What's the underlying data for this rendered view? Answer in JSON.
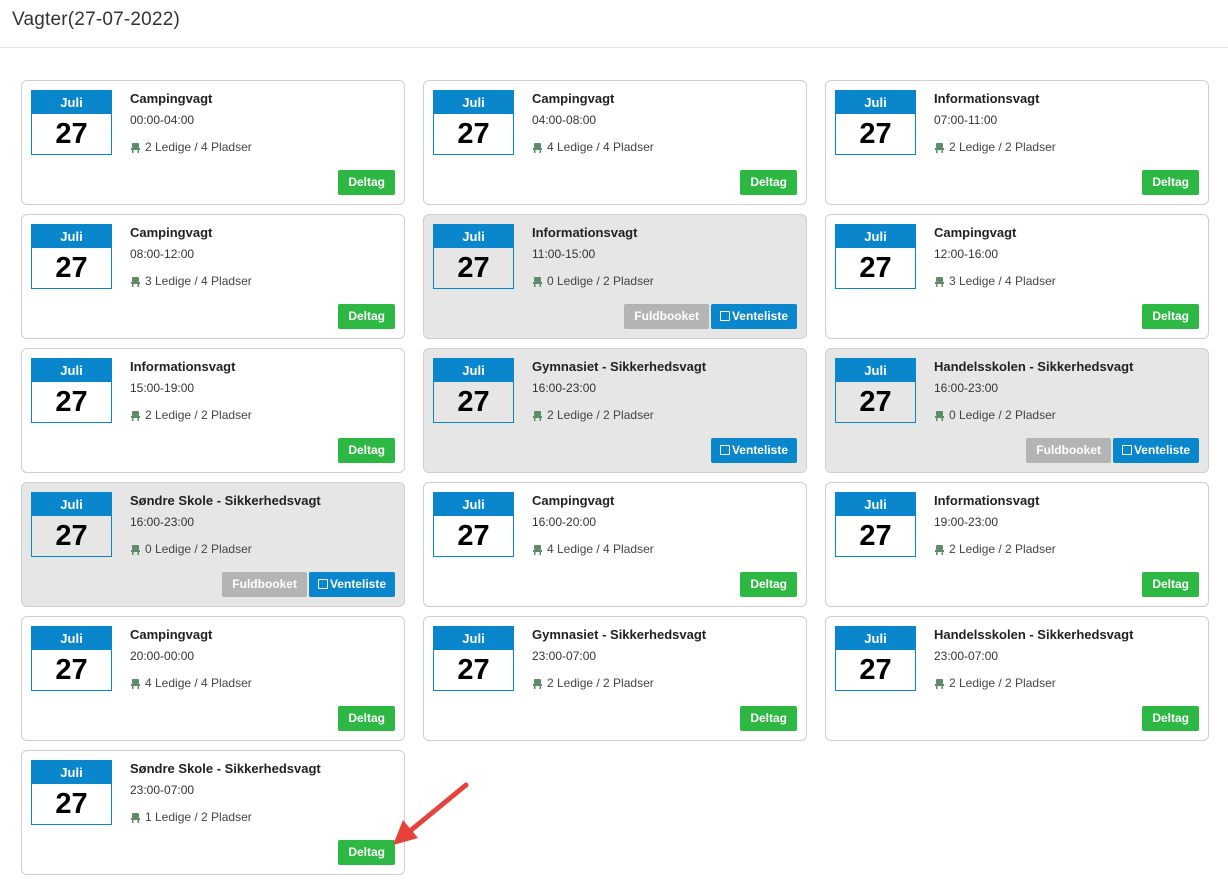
{
  "page": {
    "title": "Vagter(27-07-2022)"
  },
  "colors": {
    "accent": "#0a86cc",
    "join": "#2db843",
    "full": "#b4b4b4",
    "arrow": "#e8413c"
  },
  "icons": {
    "seats": "seat-icon",
    "waitlist": "checkbox-icon",
    "annotation": "red-arrow"
  },
  "shifts": [
    {
      "month": "Juli",
      "day": "27",
      "title": "Campingvagt",
      "time": "00:00-04:00",
      "seats": "2 Ledige / 4 Pladser",
      "state": "open",
      "join_label": "Deltag"
    },
    {
      "month": "Juli",
      "day": "27",
      "title": "Campingvagt",
      "time": "04:00-08:00",
      "seats": "4 Ledige / 4 Pladser",
      "state": "open",
      "join_label": "Deltag"
    },
    {
      "month": "Juli",
      "day": "27",
      "title": "Informationsvagt",
      "time": "07:00-11:00",
      "seats": "2 Ledige / 2 Pladser",
      "state": "open",
      "join_label": "Deltag"
    },
    {
      "month": "Juli",
      "day": "27",
      "title": "Campingvagt",
      "time": "08:00-12:00",
      "seats": "3 Ledige / 4 Pladser",
      "state": "open",
      "join_label": "Deltag"
    },
    {
      "month": "Juli",
      "day": "27",
      "title": "Informationsvagt",
      "time": "11:00-15:00",
      "seats": "0 Ledige / 2 Pladser",
      "state": "full",
      "full_label": "Fuldbooket",
      "wait_label": "Venteliste"
    },
    {
      "month": "Juli",
      "day": "27",
      "title": "Campingvagt",
      "time": "12:00-16:00",
      "seats": "3 Ledige / 4 Pladser",
      "state": "open",
      "join_label": "Deltag"
    },
    {
      "month": "Juli",
      "day": "27",
      "title": "Informationsvagt",
      "time": "15:00-19:00",
      "seats": "2 Ledige / 2 Pladser",
      "state": "open",
      "join_label": "Deltag"
    },
    {
      "month": "Juli",
      "day": "27",
      "title": "Gymnasiet - Sikkerhedsvagt",
      "time": "16:00-23:00",
      "seats": "2 Ledige / 2 Pladser",
      "state": "waitlist",
      "wait_label": "Venteliste"
    },
    {
      "month": "Juli",
      "day": "27",
      "title": "Handelsskolen - Sikkerhedsvagt",
      "time": "16:00-23:00",
      "seats": "0 Ledige / 2 Pladser",
      "state": "full",
      "full_label": "Fuldbooket",
      "wait_label": "Venteliste"
    },
    {
      "month": "Juli",
      "day": "27",
      "title": "Søndre Skole - Sikkerhedsvagt",
      "time": "16:00-23:00",
      "seats": "0 Ledige / 2 Pladser",
      "state": "full",
      "full_label": "Fuldbooket",
      "wait_label": "Venteliste"
    },
    {
      "month": "Juli",
      "day": "27",
      "title": "Campingvagt",
      "time": "16:00-20:00",
      "seats": "4 Ledige / 4 Pladser",
      "state": "open",
      "join_label": "Deltag"
    },
    {
      "month": "Juli",
      "day": "27",
      "title": "Informationsvagt",
      "time": "19:00-23:00",
      "seats": "2 Ledige / 2 Pladser",
      "state": "open",
      "join_label": "Deltag"
    },
    {
      "month": "Juli",
      "day": "27",
      "title": "Campingvagt",
      "time": "20:00-00:00",
      "seats": "4 Ledige / 4 Pladser",
      "state": "open",
      "join_label": "Deltag"
    },
    {
      "month": "Juli",
      "day": "27",
      "title": "Gymnasiet - Sikkerhedsvagt",
      "time": "23:00-07:00",
      "seats": "2 Ledige / 2 Pladser",
      "state": "open",
      "join_label": "Deltag"
    },
    {
      "month": "Juli",
      "day": "27",
      "title": "Handelsskolen - Sikkerhedsvagt",
      "time": "23:00-07:00",
      "seats": "2 Ledige / 2 Pladser",
      "state": "open",
      "join_label": "Deltag"
    },
    {
      "month": "Juli",
      "day": "27",
      "title": "Søndre Skole - Sikkerhedsvagt",
      "time": "23:00-07:00",
      "seats": "1 Ledige / 2 Pladser",
      "state": "open",
      "join_label": "Deltag"
    }
  ]
}
